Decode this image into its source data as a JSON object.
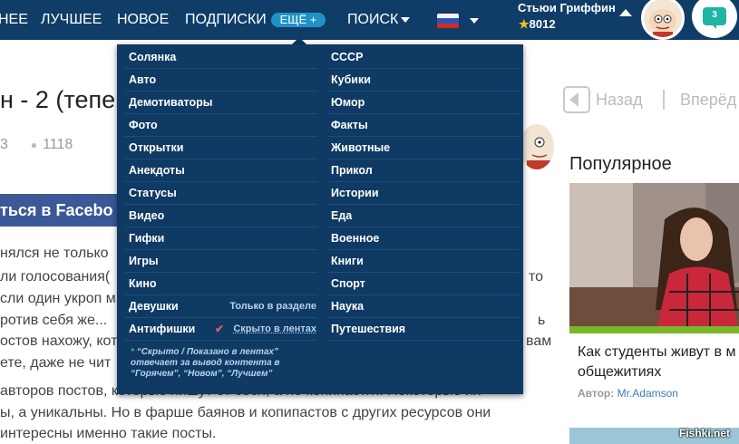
{
  "topbar": {
    "nav": [
      "НЕЕ",
      "ЛУЧШЕЕ",
      "НОВОЕ",
      "ПОДПИСКИ"
    ],
    "more_label": "ЕЩЁ +",
    "search_label": "ПОИСК",
    "user_name": "Стьюи Гриффин",
    "user_rating": "8012",
    "messages_count": "3"
  },
  "article": {
    "title": "н - 2 (тепе",
    "comments_fragment": "3",
    "views": "1118",
    "facebook_btn": "ться в Facebo",
    "body_lines": [
      "нялся не только",
      "ли голосования(",
      "сли один укроп м",
      "ротив себя же...",
      "остов нахожу, кот",
      "ете, даже не чит",
      " авторов постов, которые пишут от себя, а не копипастят. Некоторые их",
      "ы, а уникальны. Но в фарше баянов и копипастов с других ресурсов они",
      "интересны именно такие посты."
    ],
    "right_fragments": [
      "то",
      "ь",
      "вам"
    ]
  },
  "sidebar": {
    "back_label": "Назад",
    "forward_label": "Вперёд",
    "popular_heading": "Популярное",
    "card_title_lines": [
      "Как студенты живут в м",
      "общежитиях"
    ],
    "card_author_prefix": "Автор:",
    "card_author": "Mr.Adamson",
    "watermark": "Fishki.net"
  },
  "dropdown": {
    "left": [
      {
        "label": "Солянка"
      },
      {
        "label": "Авто"
      },
      {
        "label": "Демотиваторы"
      },
      {
        "label": "Фото"
      },
      {
        "label": "Открытки"
      },
      {
        "label": "Анекдоты"
      },
      {
        "label": "Статусы"
      },
      {
        "label": "Видео"
      },
      {
        "label": "Гифки"
      },
      {
        "label": "Игры"
      },
      {
        "label": "Кино"
      },
      {
        "label": "Девушки",
        "note": "Только в разделе"
      },
      {
        "label": "Антифишки",
        "note": "Скрыто в лентах",
        "mark": "✔"
      }
    ],
    "right": [
      {
        "label": "СССР"
      },
      {
        "label": "Кубики"
      },
      {
        "label": "Юмор"
      },
      {
        "label": "Факты"
      },
      {
        "label": "Животные"
      },
      {
        "label": "Прикол"
      },
      {
        "label": "Истории"
      },
      {
        "label": "Еда"
      },
      {
        "label": "Военное"
      },
      {
        "label": "Книги"
      },
      {
        "label": "Спорт"
      },
      {
        "label": "Наука"
      },
      {
        "label": "Путешествия"
      }
    ],
    "footnote": {
      "star": "*",
      "text": "“Скрыто / Показано в лентах” отвечает за вывод контента в “Горячем”, “Новом”, “Лучшем”"
    }
  },
  "colors": {
    "topbar": "#0f3d68",
    "dropdown": "#0e3a64",
    "accent": "#1f93c6",
    "facebook": "#3b5998"
  },
  "icons": [
    "eye-icon",
    "star-icon",
    "flag-ru-icon",
    "back-arrow-icon",
    "message-icon",
    "check-icon"
  ]
}
